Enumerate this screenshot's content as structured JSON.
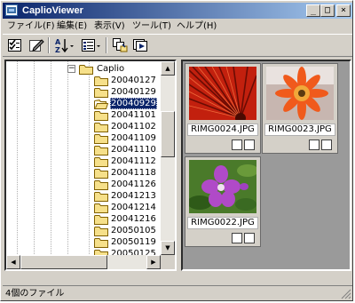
{
  "window": {
    "title": "CaplioViewer"
  },
  "titlebar": {
    "minimize": "_",
    "maximize": "□",
    "close": "×"
  },
  "menu": [
    {
      "label": "ファイル(F)"
    },
    {
      "label": "編集(E)"
    },
    {
      "label": "表示(V)"
    },
    {
      "label": "ツール(T)"
    },
    {
      "label": "ヘルプ(H)"
    }
  ],
  "toolbar": {
    "buttons": [
      {
        "icon": "checklist-icon"
      },
      {
        "icon": "edit-icon"
      },
      {
        "icon": "sort-az-icon"
      },
      {
        "icon": "view-list-icon"
      },
      {
        "icon": "copy-to-folder-icon"
      },
      {
        "icon": "slideshow-icon"
      }
    ]
  },
  "tree": {
    "expander": "−",
    "root_label": "Caplio",
    "selected": "20040929",
    "items": [
      {
        "label": "20040127"
      },
      {
        "label": "20040129"
      },
      {
        "label": "20040929"
      },
      {
        "label": "20041101"
      },
      {
        "label": "20041102"
      },
      {
        "label": "20041109"
      },
      {
        "label": "20041110"
      },
      {
        "label": "20041112"
      },
      {
        "label": "20041118"
      },
      {
        "label": "20041126"
      },
      {
        "label": "20041213"
      },
      {
        "label": "20041214"
      },
      {
        "label": "20041216"
      },
      {
        "label": "20050105"
      },
      {
        "label": "20050119"
      },
      {
        "label": "20050125"
      },
      {
        "label": "20050126"
      }
    ]
  },
  "images": [
    {
      "filename": "RIMG0024.JPG",
      "subject": "red-umbrella-ribs-photo"
    },
    {
      "filename": "RIMG0023.JPG",
      "subject": "orange-gerbera-photo"
    },
    {
      "filename": "RIMG0022.JPG",
      "subject": "purple-flower-photo"
    }
  ],
  "scroll": {
    "up": "▲",
    "down": "▼",
    "left": "◀",
    "right": "▶"
  },
  "status": {
    "text": "4個のファイル"
  },
  "colors": {
    "titlebar_start": "#0a246a",
    "titlebar_end": "#a6caf0",
    "selection": "#0a246a",
    "folder": "#f6e08a",
    "image_pane_bg": "#9a9a9a"
  }
}
